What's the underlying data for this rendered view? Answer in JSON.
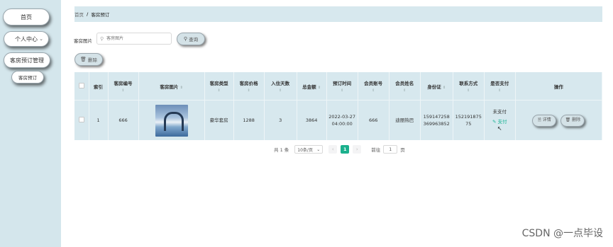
{
  "sidebar": {
    "items": [
      {
        "label": "首页"
      },
      {
        "label": "个人中心",
        "chevron": "chevron-down-icon"
      },
      {
        "label": "客房预订管理"
      },
      {
        "label": "客房预订"
      }
    ]
  },
  "breadcrumb": {
    "home": "首页",
    "separator": "/",
    "current": "客房预订"
  },
  "search": {
    "label": "客房图片",
    "placeholder": "客房图片",
    "search_icon": "search-icon",
    "query_button": "查询"
  },
  "toolbar": {
    "delete_label": "删除",
    "delete_icon": "trash-icon"
  },
  "table": {
    "headers": [
      "",
      "索引",
      "客房编号",
      "客房图片",
      "客房类型",
      "客房价格",
      "入住天数",
      "总金额",
      "预订时间",
      "会员账号",
      "会员姓名",
      "身份证",
      "联系方式",
      "是否支付",
      "操作"
    ],
    "rows": [
      {
        "index": "1",
        "room_no": "666",
        "room_image": "room-photo",
        "room_type": "豪华套房",
        "price": "1288",
        "days": "3",
        "total": "3864",
        "booking_time": "2022-03-27 04:00:00",
        "member_account": "666",
        "member_name": "迪丽热巴",
        "id_card": "159147258369963852",
        "phone": "15219187575",
        "pay_status": "未支付",
        "pay_link": "支付",
        "detail_button": "详情",
        "delete_button": "删除"
      }
    ]
  },
  "pagination": {
    "total": "共 1 条",
    "page_size": "10条/页",
    "current_page": "1",
    "goto_label": "前往",
    "goto_value": "1",
    "page_suffix": "页"
  },
  "watermark": "CSDN @一点毕设",
  "colors": {
    "sidebar_bg": "#d4e6ec",
    "accent": "#1bb08d",
    "table_header_bg": "#d7e8ee"
  }
}
